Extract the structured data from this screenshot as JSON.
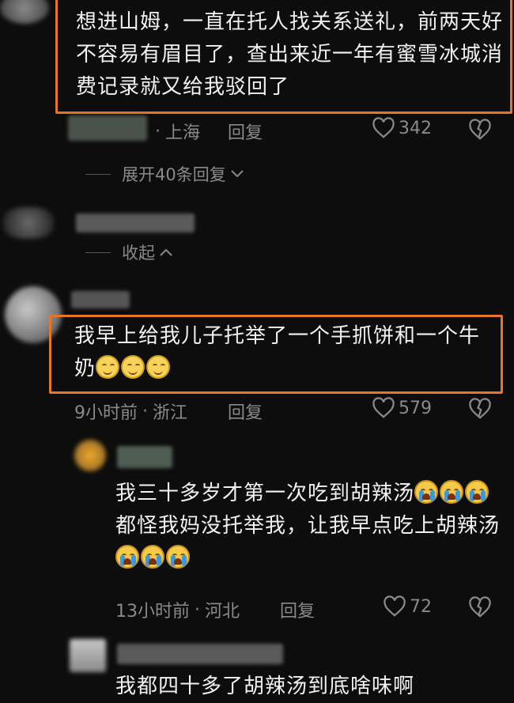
{
  "comment1": {
    "text": "想进山姆，一直在托人找关系送礼，前两天好不容易有眉目了，查出来近一年有蜜雪冰城消费记录就又给我驳回了",
    "location": "上海",
    "reply_label": "回复",
    "likes": "342",
    "expand_label": "展开40条回复"
  },
  "comment2": {
    "collapse_label": "收起"
  },
  "comment3": {
    "text": "我早上给我儿子托举了一个手抓饼和一个牛奶",
    "time": "9小时前",
    "location": "浙江",
    "reply_label": "回复",
    "likes": "579"
  },
  "reply1": {
    "text_part1": "我三十多岁才第一次吃到胡辣汤",
    "text_part2": "都怪我妈没托举我，让我早点吃上胡辣汤",
    "time": "13小时前",
    "location": "河北",
    "reply_label": "回复",
    "likes": "72"
  },
  "reply2": {
    "text": "我都四十多了胡辣汤到底啥味啊"
  },
  "colors": {
    "accent_border": "#e8742c",
    "background": "#0d0d0d",
    "meta_text": "#8a8a8a"
  },
  "icons": [
    "heart-outline-icon",
    "broken-heart-icon",
    "chevron-down-icon",
    "chevron-up-icon",
    "smile-emoji-icon",
    "crying-emoji-icon"
  ]
}
